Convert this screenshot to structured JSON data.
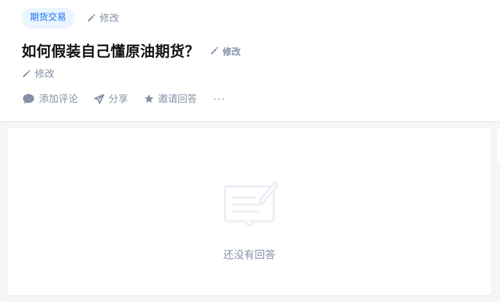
{
  "header": {
    "topic_tag": "期货交易",
    "topic_edit_label": "修改",
    "title": "如何假装自己懂原油期货？",
    "title_edit_label": "修改",
    "description_edit_label": "修改",
    "actions": {
      "comment": "添加评论",
      "share": "分享",
      "invite": "邀请回答",
      "more": "···"
    }
  },
  "answers": {
    "empty_text": "还没有回答"
  },
  "colors": {
    "accent": "#1772f6",
    "tag_bg": "#ebf5ff",
    "muted": "#8590a6",
    "page_bg": "#f6f6f6"
  },
  "icons": [
    "pencil-icon",
    "comment-icon",
    "share-icon",
    "star-icon",
    "more-icon",
    "empty-answer-icon"
  ]
}
